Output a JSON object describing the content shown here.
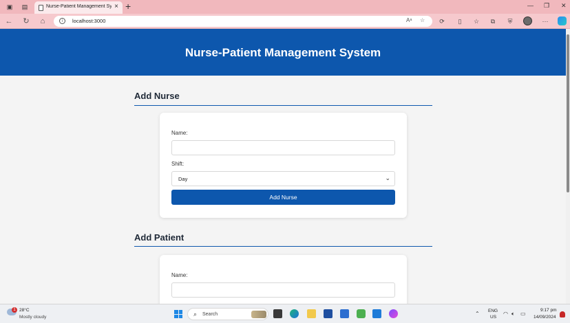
{
  "browser": {
    "tab_title": "Nurse-Patient Management Syste",
    "url": "localhost:3000"
  },
  "page": {
    "title": "Nurse-Patient Management System",
    "add_nurse": {
      "heading": "Add Nurse",
      "name_label": "Name:",
      "name_value": "",
      "shift_label": "Shift:",
      "shift_value": "Day",
      "submit_label": "Add Nurse"
    },
    "add_patient": {
      "heading": "Add Patient",
      "name_label": "Name:",
      "name_value": ""
    }
  },
  "taskbar": {
    "weather_temp": "28°C",
    "weather_desc": "Mostly cloudy",
    "weather_badge": "1",
    "search_placeholder": "Search",
    "lang_primary": "ENG",
    "lang_secondary": "US",
    "time": "9:17 pm",
    "date": "14/09/2024"
  },
  "colors": {
    "accent": "#0d57ad",
    "tabbar": "#f1b8bd",
    "page_bg": "#f4f4f4"
  }
}
